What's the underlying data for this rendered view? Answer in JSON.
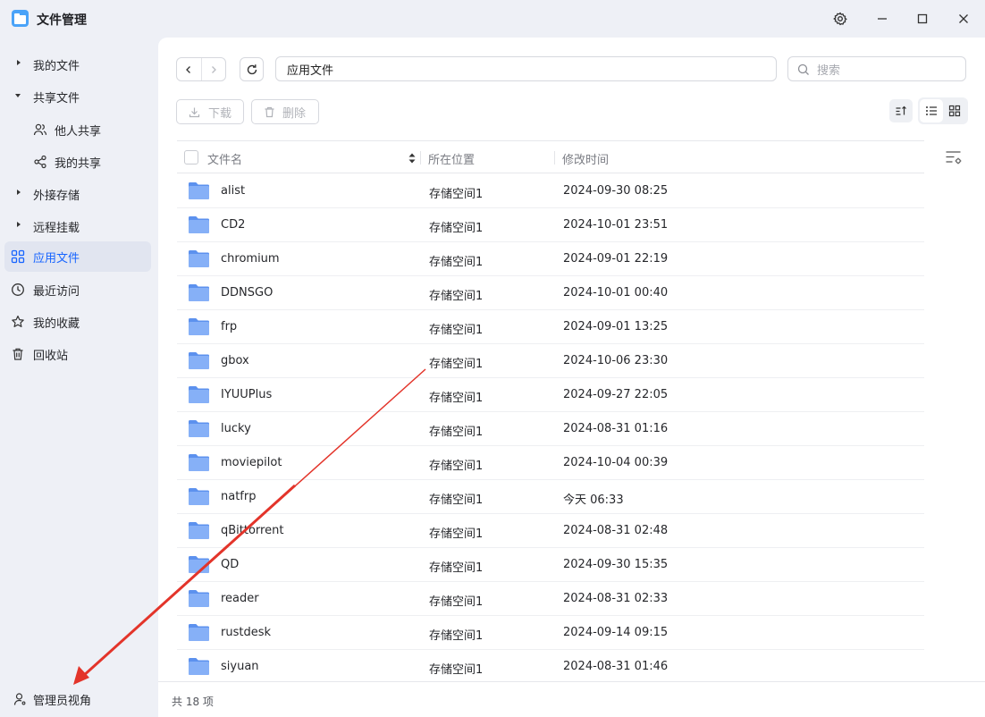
{
  "app": {
    "title": "文件管理"
  },
  "sidebar": {
    "items": [
      {
        "label": "我的文件"
      },
      {
        "label": "共享文件"
      },
      {
        "label": "他人共享"
      },
      {
        "label": "我的共享"
      },
      {
        "label": "外接存储"
      },
      {
        "label": "远程挂载"
      },
      {
        "label": "应用文件"
      },
      {
        "label": "最近访问"
      },
      {
        "label": "我的收藏"
      },
      {
        "label": "回收站"
      }
    ],
    "admin_view": "管理员视角"
  },
  "toolbar": {
    "path": "应用文件",
    "search_placeholder": "搜索",
    "download_label": "下载",
    "delete_label": "删除"
  },
  "table": {
    "headers": {
      "name": "文件名",
      "location": "所在位置",
      "modified": "修改时间"
    },
    "rows": [
      {
        "name": "alist",
        "location": "存储空间1",
        "modified": "2024-09-30 08:25"
      },
      {
        "name": "CD2",
        "location": "存储空间1",
        "modified": "2024-10-01 23:51"
      },
      {
        "name": "chromium",
        "location": "存储空间1",
        "modified": "2024-09-01 22:19"
      },
      {
        "name": "DDNSGO",
        "location": "存储空间1",
        "modified": "2024-10-01 00:40"
      },
      {
        "name": "frp",
        "location": "存储空间1",
        "modified": "2024-09-01 13:25"
      },
      {
        "name": "gbox",
        "location": "存储空间1",
        "modified": "2024-10-06 23:30"
      },
      {
        "name": "IYUUPlus",
        "location": "存储空间1",
        "modified": "2024-09-27 22:05"
      },
      {
        "name": "lucky",
        "location": "存储空间1",
        "modified": "2024-08-31 01:16"
      },
      {
        "name": "moviepilot",
        "location": "存储空间1",
        "modified": "2024-10-04 00:39"
      },
      {
        "name": "natfrp",
        "location": "存储空间1",
        "modified": "今天 06:33"
      },
      {
        "name": "qBittorrent",
        "location": "存储空间1",
        "modified": "2024-08-31 02:48"
      },
      {
        "name": "QD",
        "location": "存储空间1",
        "modified": "2024-09-30 15:35"
      },
      {
        "name": "reader",
        "location": "存储空间1",
        "modified": "2024-08-31 02:33"
      },
      {
        "name": "rustdesk",
        "location": "存储空间1",
        "modified": "2024-09-14 09:15"
      },
      {
        "name": "siyuan",
        "location": "存储空间1",
        "modified": "2024-08-31 01:46"
      }
    ]
  },
  "footer": {
    "count": "共 18 项"
  },
  "colors": {
    "accent": "#1664ff",
    "folder": "#6fa1f5",
    "annotation_arrow": "#e3342a"
  }
}
